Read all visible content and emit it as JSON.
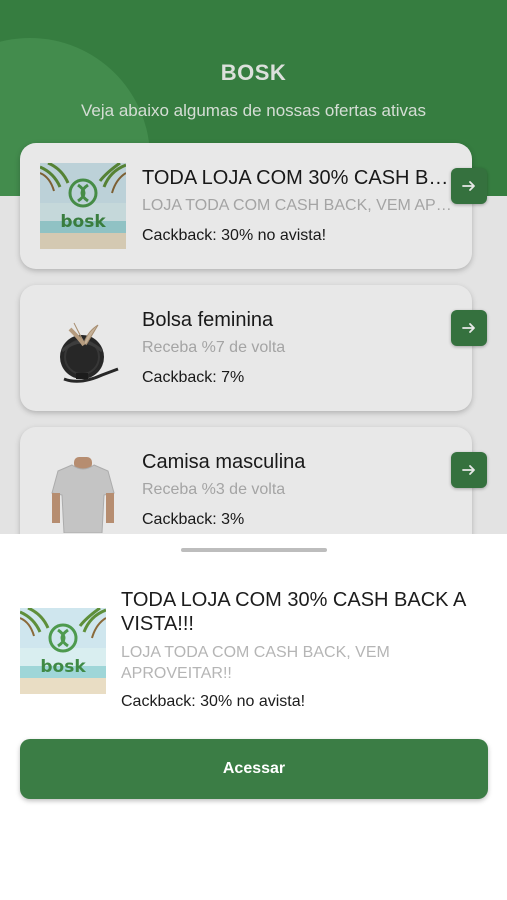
{
  "header": {
    "brand": "BOSK",
    "subtitle": "Veja abaixo algumas de nossas ofertas ativas"
  },
  "offers": [
    {
      "title": "TODA LOJA COM 30% CASH BACK A VISTA!!!",
      "description": "LOJA TODA COM CASH BACK, VEM APROVEITAR!!",
      "cashback": "Cackback: 30% no avista!",
      "image_icon": "bosk-logo-image"
    },
    {
      "title": "Bolsa feminina",
      "description": "Receba %7 de volta",
      "cashback": "Cackback: 7%",
      "image_icon": "handbag-image"
    },
    {
      "title": "Camisa masculina",
      "description": "Receba %3 de volta",
      "cashback": "Cackback: 3%",
      "image_icon": "tshirt-image"
    }
  ],
  "sheet": {
    "title": "TODA LOJA COM 30% CASH BACK A VISTA!!!",
    "description": "LOJA TODA COM CASH BACK, VEM APROVEITAR!!",
    "cashback": "Cackback: 30% no avista!",
    "button_label": "Acessar",
    "logo_text": "bosk"
  },
  "colors": {
    "primary": "#3b7d45",
    "header": "#3c8a47",
    "muted_text": "#b5b5b5"
  },
  "icons": {
    "arrow": "arrow-right-icon"
  }
}
